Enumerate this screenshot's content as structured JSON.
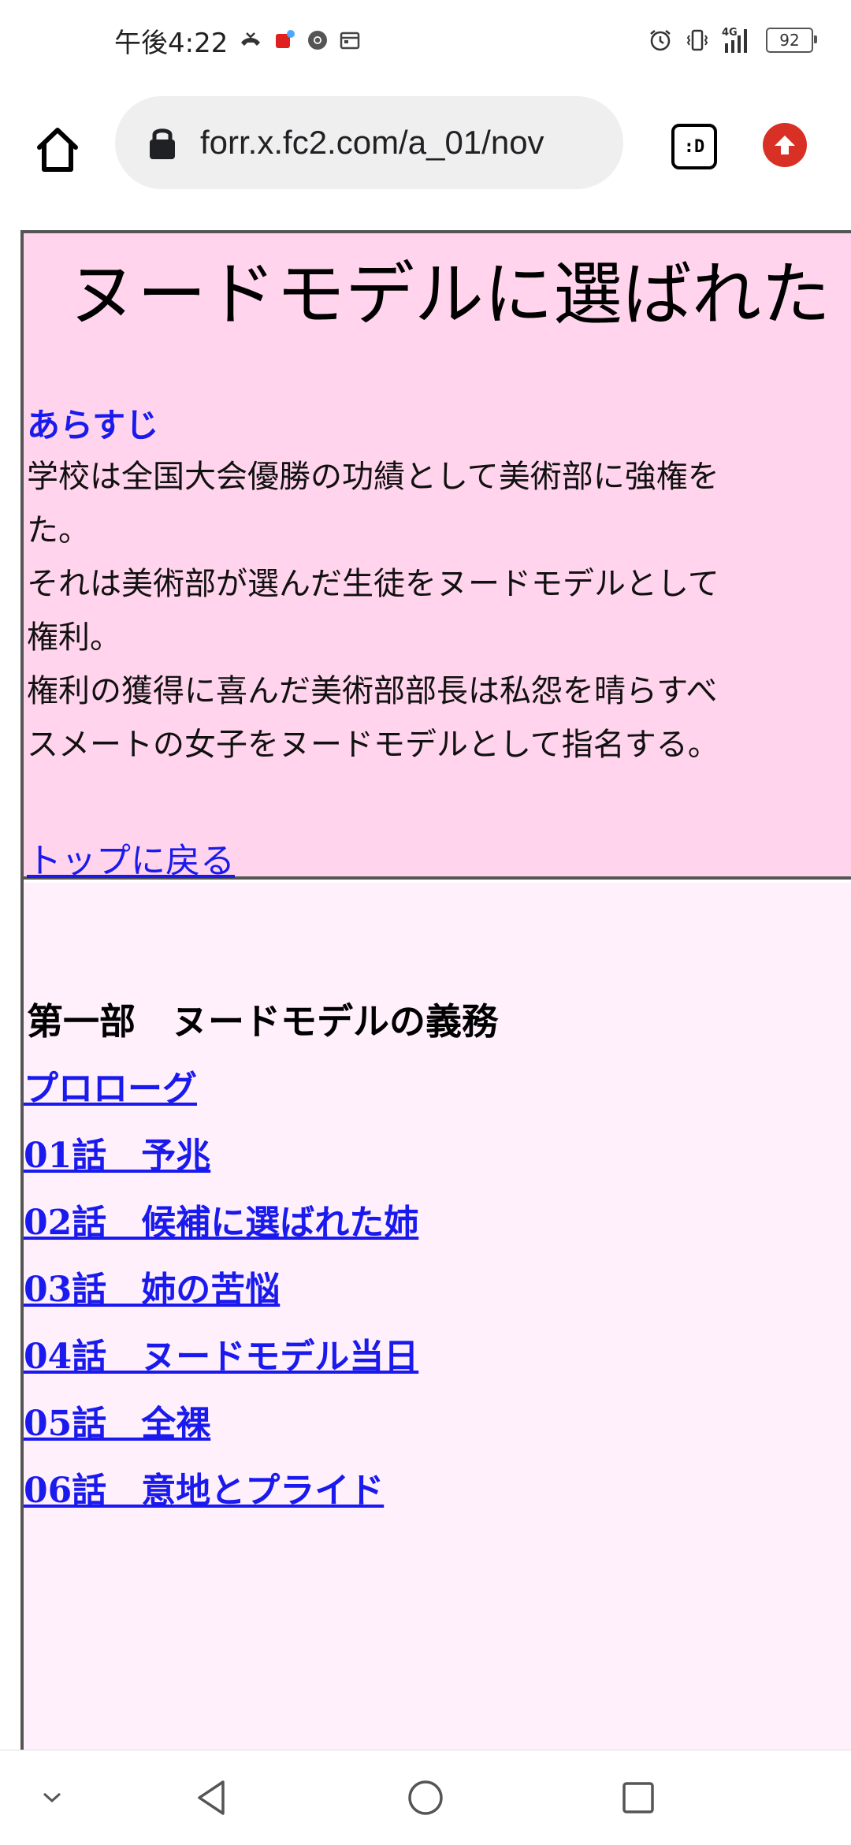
{
  "status_bar": {
    "time": "午後4:22",
    "network": "4G",
    "battery": "92"
  },
  "browser": {
    "url": "forr.x.fc2.com/a_01/nov",
    "tab_label": ":D"
  },
  "page": {
    "title": "ヌードモデルに選ばれた",
    "synopsis_heading": "あらすじ",
    "synopsis_lines": [
      "学校は全国大会優勝の功績として美術部に強権を",
      "た。",
      "それは美術部が選んだ生徒をヌードモデルとして",
      "権利。",
      "権利の獲得に喜んだ美術部部長は私怨を晴らすべ",
      "スメートの女子をヌードモデルとして指名する。"
    ],
    "back_link": "トップに戻る",
    "part_title": "第一部　ヌードモデルの義務",
    "chapters": [
      "プロローグ",
      "01話　予兆",
      "02話　候補に選ばれた姉",
      "03話　姉の苦悩",
      "04話　ヌードモデル当日",
      "05話　全裸",
      "06話　意地とプライド"
    ]
  },
  "colors": {
    "header_bg": "#ffd4ec",
    "toc_bg": "#fff0fb",
    "link": "#1a1aee"
  }
}
